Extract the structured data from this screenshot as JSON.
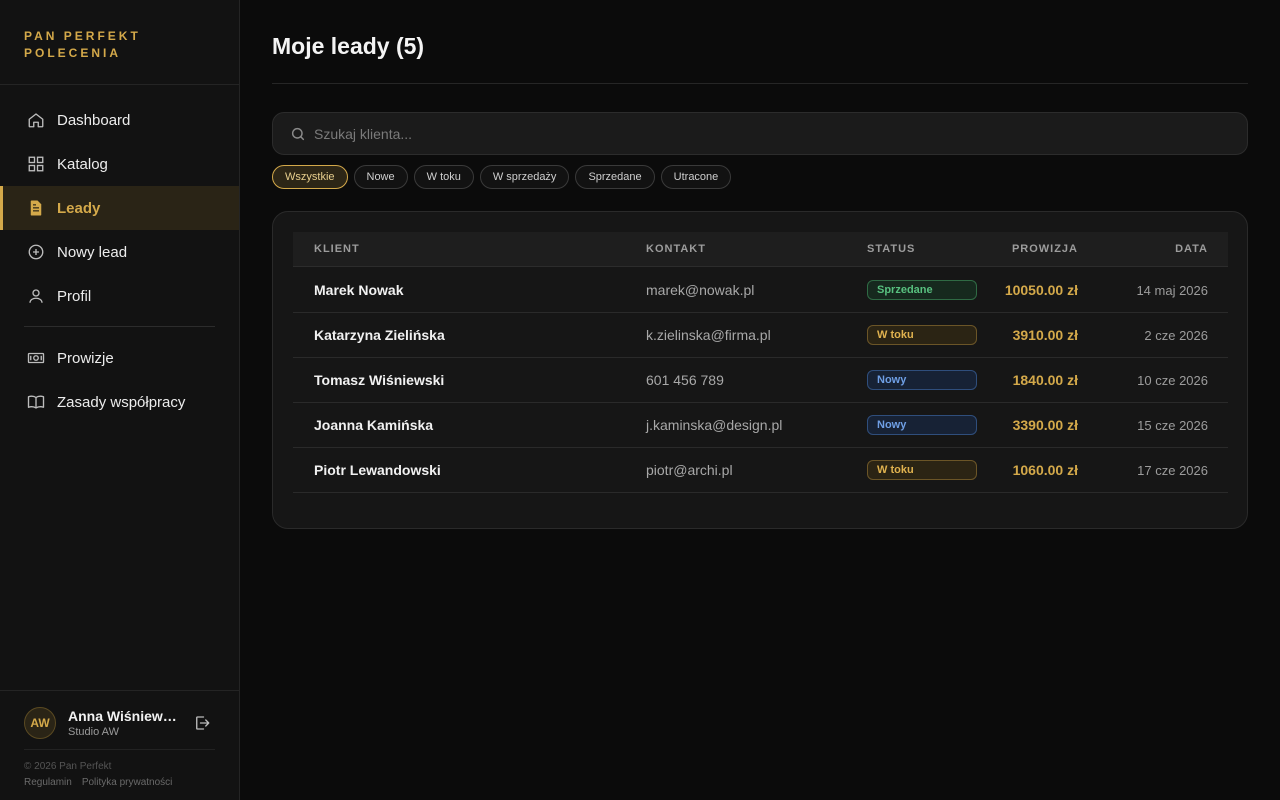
{
  "brand": {
    "line1": "PAN PERFEKT",
    "line2": "POLECENIA"
  },
  "nav": {
    "items": [
      {
        "label": "Dashboard",
        "icon": "home-icon"
      },
      {
        "label": "Katalog",
        "icon": "grid-icon"
      },
      {
        "label": "Leady",
        "icon": "document-icon",
        "active": true
      },
      {
        "label": "Nowy lead",
        "icon": "plus-circle-icon"
      },
      {
        "label": "Profil",
        "icon": "user-icon"
      }
    ],
    "secondary": [
      {
        "label": "Prowizje",
        "icon": "money-icon"
      },
      {
        "label": "Zasady współpracy",
        "icon": "book-icon"
      }
    ]
  },
  "user": {
    "initials": "AW",
    "name": "Anna Wiśniewska",
    "company": "Studio AW"
  },
  "footer": {
    "copyright": "© 2026 Pan Perfekt",
    "terms": "Regulamin",
    "privacy": "Polityka prywatności"
  },
  "page": {
    "title": "Moje leady (5)"
  },
  "search": {
    "placeholder": "Szukaj klienta...",
    "value": ""
  },
  "filters": [
    "Wszystkie",
    "Nowe",
    "W toku",
    "W sprzedaży",
    "Sprzedane",
    "Utracone"
  ],
  "active_filter": "Wszystkie",
  "table": {
    "headers": {
      "client": "KLIENT",
      "contact": "KONTAKT",
      "status": "STATUS",
      "commission": "PROWIZJA",
      "date": "DATA"
    },
    "rows": [
      {
        "client": "Marek Nowak",
        "contact": "marek@nowak.pl",
        "status": "Sprzedane",
        "status_type": "sold",
        "commission": "10050.00 zł",
        "date": "14 maj 2026"
      },
      {
        "client": "Katarzyna Zielińska",
        "contact": "k.zielinska@firma.pl",
        "status": "W toku",
        "status_type": "progress",
        "commission": "3910.00 zł",
        "date": "2 cze 2026"
      },
      {
        "client": "Tomasz Wiśniewski",
        "contact": "601 456 789",
        "status": "Nowy",
        "status_type": "new",
        "commission": "1840.00 zł",
        "date": "10 cze 2026"
      },
      {
        "client": "Joanna Kamińska",
        "contact": "j.kaminska@design.pl",
        "status": "Nowy",
        "status_type": "new",
        "commission": "3390.00 zł",
        "date": "15 cze 2026"
      },
      {
        "client": "Piotr Lewandowski",
        "contact": "piotr@archi.pl",
        "status": "W toku",
        "status_type": "progress",
        "commission": "1060.00 zł",
        "date": "17 cze 2026"
      }
    ]
  },
  "colors": {
    "accent": "#d4a94a",
    "background": "#0b0b0b",
    "sidebar": "#121212",
    "sold": "#58c07f",
    "progress": "#e0b24f",
    "new": "#6f9fe5"
  }
}
